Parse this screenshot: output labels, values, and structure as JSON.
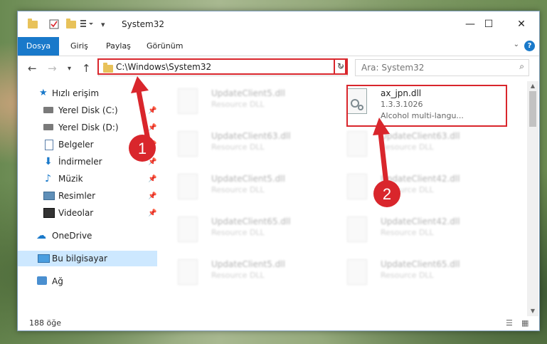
{
  "window": {
    "title": "System32"
  },
  "ribbon": {
    "file_tab": "Dosya",
    "tabs": [
      "Giriş",
      "Paylaş",
      "Görünüm"
    ]
  },
  "nav": {
    "address": "C:\\Windows\\System32",
    "search_placeholder": "Ara: System32"
  },
  "sidebar": {
    "quick_access": "Hızlı erişim",
    "items": [
      {
        "label": "Yerel Disk (C:)",
        "icon": "drive-icon",
        "pinned": true
      },
      {
        "label": "Yerel Disk (D:)",
        "icon": "drive-icon",
        "pinned": true
      },
      {
        "label": "Belgeler",
        "icon": "documents-icon",
        "pinned": true
      },
      {
        "label": "İndirmeler",
        "icon": "download-icon",
        "pinned": true
      },
      {
        "label": "Müzik",
        "icon": "music-icon",
        "pinned": true
      },
      {
        "label": "Resimler",
        "icon": "pictures-icon",
        "pinned": true
      },
      {
        "label": "Videolar",
        "icon": "videos-icon",
        "pinned": true
      }
    ],
    "onedrive": "OneDrive",
    "this_pc": "Bu bilgisayar",
    "network": "Ağ"
  },
  "files": {
    "left_column": [
      {
        "name": "UpdateClient5.dll",
        "sub": "Resource DLL"
      },
      {
        "name": "UpdateClient63.dll",
        "sub": "Resource DLL"
      },
      {
        "name": "UpdateClient5.dll",
        "sub": "Resource DLL"
      },
      {
        "name": "UpdateClient65.dll",
        "sub": "Resource DLL"
      },
      {
        "name": "UpdateClient5.dll",
        "sub": "Resource DLL"
      }
    ],
    "right_column": [
      {
        "name": "UpdateClient63.dll",
        "sub": "Resource DLL"
      },
      {
        "name": "UpdateClient42.dll",
        "sub": "Resource DLL"
      },
      {
        "name": "UpdateClient42.dll",
        "sub": "Resource DLL"
      },
      {
        "name": "UpdateClient65.dll",
        "sub": "Resource DLL"
      }
    ],
    "highlighted": {
      "name": "ax_jpn.dll",
      "version": "1.3.3.1026",
      "description": "Alcohol multi-langu..."
    }
  },
  "status": {
    "count": "188 öğe"
  },
  "annotations": {
    "one": "1",
    "two": "2"
  },
  "colors": {
    "accent": "#1979ca",
    "annotation_red": "#d9262c"
  }
}
